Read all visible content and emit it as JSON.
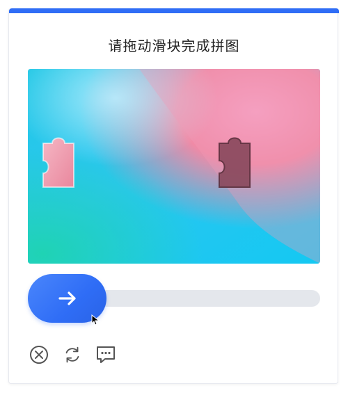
{
  "header": {
    "title": "请拖动滑块完成拼图"
  },
  "slider": {
    "handle_icon": "arrow-right-icon"
  },
  "toolbar": {
    "icons": [
      "close-circle-icon",
      "refresh-icon",
      "feedback-icon"
    ]
  },
  "colors": {
    "accent": "#2f6df6",
    "track": "#e4e7ec",
    "icon": "#555555"
  }
}
